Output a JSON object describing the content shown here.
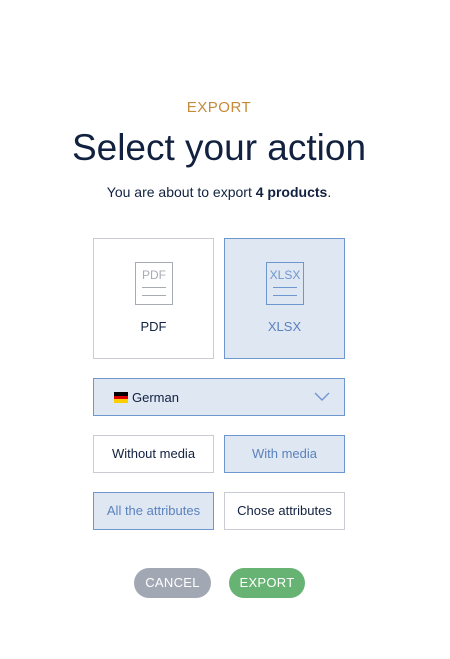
{
  "header": {
    "eyebrow": "EXPORT",
    "title": "Select your action",
    "subtitle_prefix": "You are about to export ",
    "subtitle_count": "4 products",
    "subtitle_suffix": "."
  },
  "formats": [
    {
      "name": "PDF",
      "icon_text": "PDF",
      "label": "PDF",
      "selected": false
    },
    {
      "name": "XLSX",
      "icon_text": "XLSX",
      "label": "XLSX",
      "selected": true
    }
  ],
  "locale": {
    "flag_icon": "german-flag-icon",
    "label": "German",
    "flag_colors": [
      "#000000",
      "#dd0000",
      "#ffce00"
    ]
  },
  "media_options": [
    {
      "label": "Without media",
      "selected": false
    },
    {
      "label": "With media",
      "selected": true
    }
  ],
  "attribute_options": [
    {
      "label": "All the attributes",
      "selected": true
    },
    {
      "label": "Chose attributes",
      "selected": false
    }
  ],
  "actions": {
    "cancel_label": "CANCEL",
    "export_label": "EXPORT"
  },
  "colors": {
    "accent": "#c58a3a",
    "selected_bg": "#dfe7f3",
    "selected_border": "#6e96cf",
    "cancel": "#a2a8b3",
    "export": "#67b373"
  }
}
